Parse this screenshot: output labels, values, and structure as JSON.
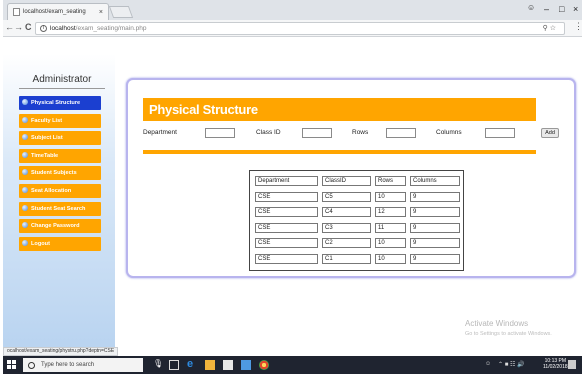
{
  "browser": {
    "tab_title": "localhost/exam_seating",
    "tab_close": "×",
    "url_host": "localhost",
    "url_path": "/exam_seating/main.php",
    "back": "←",
    "forward": "→",
    "reload": "C",
    "minimize": "–",
    "maximize": "□",
    "close": "×"
  },
  "sidebar": {
    "title": "Administrator",
    "items": [
      {
        "label": "Physical Structure",
        "active": true
      },
      {
        "label": "Faculty List"
      },
      {
        "label": "Subject List"
      },
      {
        "label": "TimeTable"
      },
      {
        "label": "Student Subjects"
      },
      {
        "label": "Seat Allocation"
      },
      {
        "label": "Student Seat Search"
      },
      {
        "label": "Change Password"
      },
      {
        "label": "Logout"
      }
    ]
  },
  "main": {
    "heading": "Physical Structure",
    "form": {
      "department_label": "Department",
      "classid_label": "Class ID",
      "rows_label": "Rows",
      "columns_label": "Columns",
      "add_label": "Add"
    },
    "table": {
      "headers": [
        "Department",
        "ClassID",
        "Rows",
        "Columns"
      ],
      "rows": [
        [
          "CSE",
          "C5",
          "10",
          "9"
        ],
        [
          "CSE",
          "C4",
          "12",
          "9"
        ],
        [
          "CSE",
          "C3",
          "11",
          "9"
        ],
        [
          "CSE",
          "C2",
          "10",
          "9"
        ],
        [
          "CSE",
          "C1",
          "10",
          "9"
        ]
      ]
    }
  },
  "watermark": {
    "line1": "Activate Windows",
    "line2": "Go to Settings to activate Windows."
  },
  "status_url": "ocalhost/exam_seating/phystru.php?deptn=CSE",
  "taskbar": {
    "search_placeholder": "Type here to search",
    "time": "10:13 PM",
    "date": "11/02/2018"
  },
  "colors": {
    "accent_orange": "#ffa500",
    "active_blue": "#1b3fd0",
    "card_border": "#b8b4ee"
  }
}
